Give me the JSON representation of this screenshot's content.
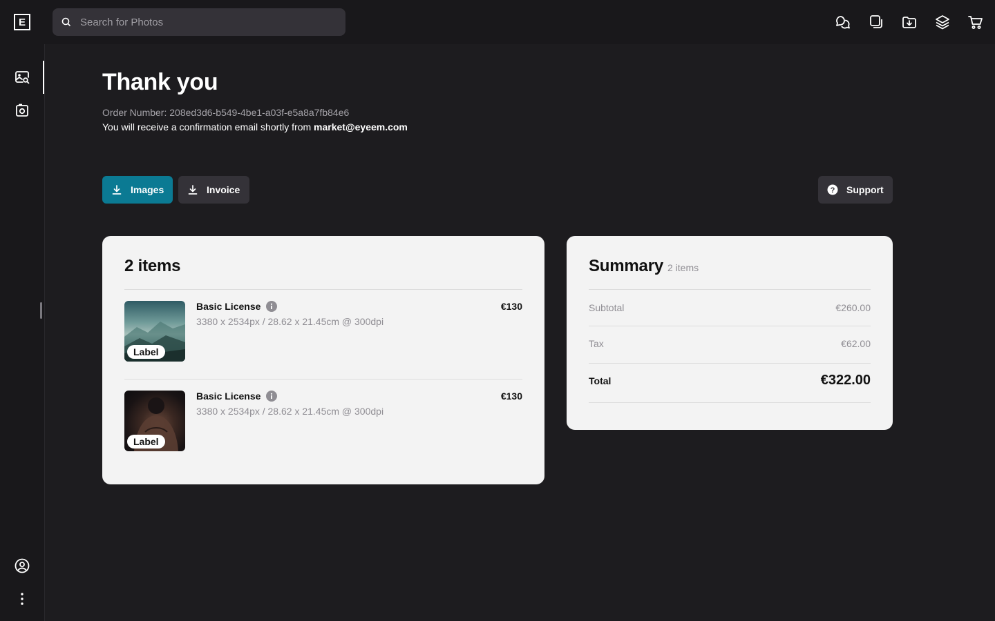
{
  "header": {
    "logo_letter": "E",
    "search_placeholder": "Search for Photos"
  },
  "top_icons": [
    "chat-bubbles-icon",
    "copy-icon",
    "download-folder-icon",
    "layers-icon",
    "cart-icon"
  ],
  "sidebar_icons": [
    "image-search-icon",
    "camera-icon",
    "user-circle-icon",
    "more-vertical-icon"
  ],
  "page": {
    "title": "Thank you",
    "order_number": "Order Number: 208ed3d6-b549-4be1-a03f-e5a8a7fb84e6",
    "confirm_text": "You will receive a confirmation email shortly from ",
    "confirm_email": "market@eyeem.com"
  },
  "actions": {
    "images_label": "Images",
    "invoice_label": "Invoice",
    "support_label": "Support"
  },
  "items_card": {
    "title": "2 items",
    "items": [
      {
        "license": "Basic License",
        "dims": "3380 x 2534px / 28.62 x 21.45cm @ 300dpi",
        "price": "€130",
        "tag": "Label"
      },
      {
        "license": "Basic License",
        "dims": "3380 x 2534px / 28.62 x 21.45cm @ 300dpi",
        "price": "€130",
        "tag": "Label"
      }
    ]
  },
  "summary": {
    "title": "Summary",
    "count": "2 items",
    "subtotal_label": "Subtotal",
    "subtotal_value": "€260.00",
    "tax_label": "Tax",
    "tax_value": "€62.00",
    "total_label": "Total",
    "total_value": "€322.00"
  },
  "colors": {
    "accent": "#0b7a93",
    "background": "#1d1c1f",
    "card": "#f3f3f3"
  }
}
